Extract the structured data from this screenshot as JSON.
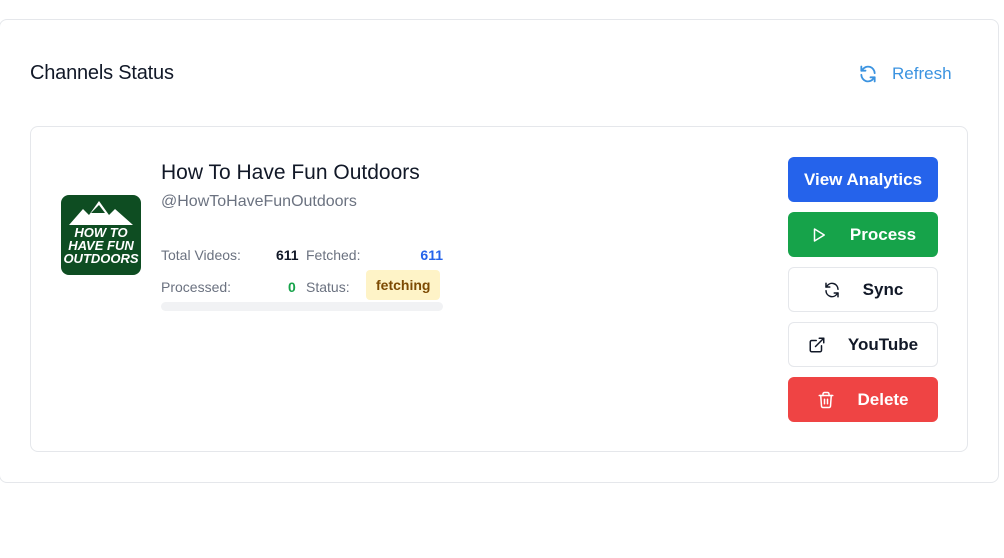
{
  "panel": {
    "title": "Channels Status",
    "refresh_label": "Refresh"
  },
  "channel": {
    "name": "How To Have Fun Outdoors",
    "handle": "@HowToHaveFunOutdoors",
    "logo_text": [
      "HOW TO",
      "HAVE FUN",
      "OUTDOORS"
    ],
    "stats": {
      "total_videos_label": "Total Videos:",
      "total_videos": "611",
      "fetched_label": "Fetched:",
      "fetched": "611",
      "processed_label": "Processed:",
      "processed": "0",
      "status_label": "Status:",
      "status": "fetching"
    },
    "progress_fraction": 0.0
  },
  "actions": {
    "view_analytics": "View Analytics",
    "process": "Process",
    "sync": "Sync",
    "youtube": "YouTube",
    "delete": "Delete"
  },
  "colors": {
    "accent_blue": "#2563eb",
    "refresh_blue": "#3b93e0",
    "process_green": "#16a34a",
    "delete_red": "#ef4444",
    "status_badge_bg": "#fef3c7",
    "logo_bg": "#0e4d22"
  },
  "icons": {
    "refresh": "refresh-icon",
    "process": "play-icon",
    "sync": "sync-icon",
    "youtube": "external-link-icon",
    "delete": "trash-icon"
  }
}
